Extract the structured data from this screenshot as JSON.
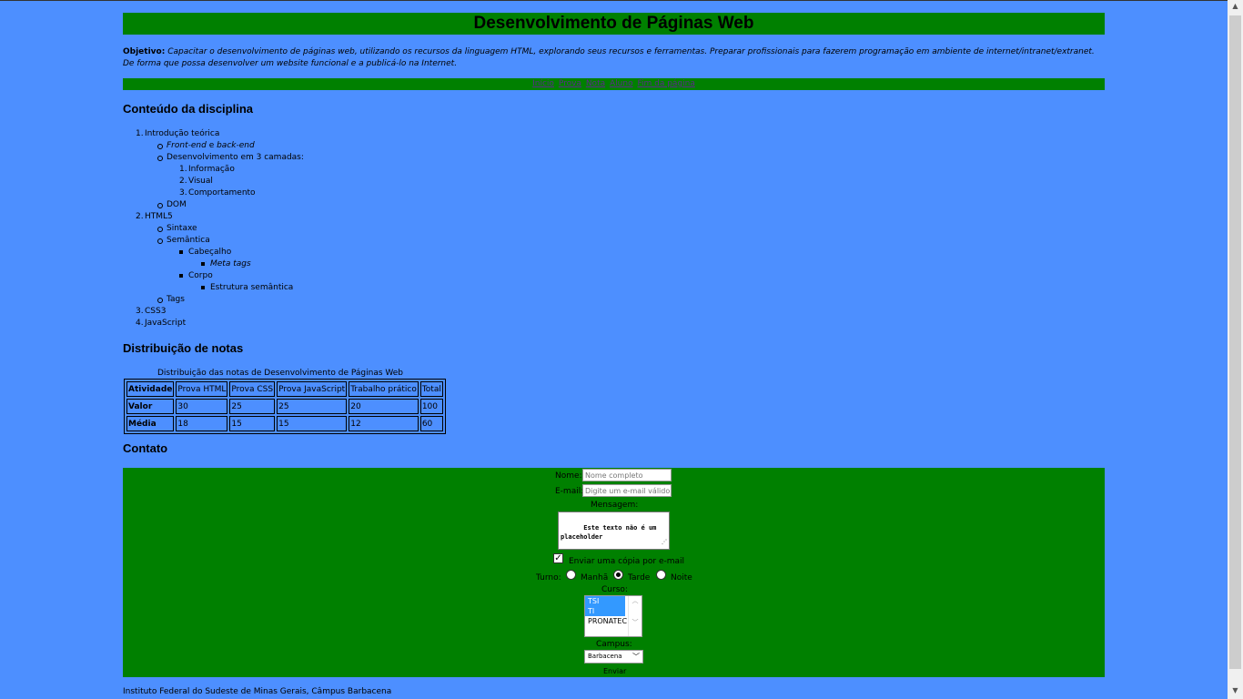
{
  "header": {
    "title": "Desenvolvimento de Páginas Web"
  },
  "objective": {
    "label": "Objetivo:",
    "text": "Capacitar o desenvolvimento de páginas web, utilizando os recursos da linguagem HTML, explorando seus recursos e ferramentas. Preparar profissionais para fazerem programação em ambiente de internet/intranet/extranet. De forma que possa desenvolver um website funcional e a publicá-lo na Internet."
  },
  "nav": [
    "Início",
    "Prova",
    "Nota",
    "Aluno",
    "Fim da página"
  ],
  "syllabus": {
    "heading": "Conteúdo da disciplina",
    "items": {
      "i1": "Introdução teórica",
      "i1a_em": "Front-end",
      "i1a_mid": " e ",
      "i1a_em2": "back-end",
      "i1b": "Desenvolvimento em 3 camadas:",
      "i1b1": "Informação",
      "i1b2": "Visual",
      "i1b3": "Comportamento",
      "i1c": "DOM",
      "i2": "HTML5",
      "i2a": "Sintaxe",
      "i2b": "Semântica",
      "i2b1": "Cabeçalho",
      "i2b1a": "Meta tags",
      "i2b2": "Corpo",
      "i2b2a": "Estrutura semântica",
      "i2c": "Tags",
      "i3": "CSS3",
      "i4": "JavaScript"
    }
  },
  "grades": {
    "heading": "Distribuição de notas",
    "caption": "Distribuição das notas de Desenvolvimento de Páginas Web",
    "columns": [
      "Atividade",
      "Prova HTML",
      "Prova CSS",
      "Prova JavaScript",
      "Trabalho prático",
      "Total"
    ],
    "rows": [
      [
        "Valor",
        "30",
        "25",
        "25",
        "20",
        "100"
      ],
      [
        "Média",
        "18",
        "15",
        "15",
        "12",
        "60"
      ]
    ]
  },
  "contact": {
    "heading": "Contato",
    "name_label": "Nome:",
    "name_placeholder": "Nome completo",
    "email_label": "E-mail:",
    "email_placeholder": "Digite um e-mail válido",
    "message_label": "Mensagem:",
    "message_value": "Este texto não é um placeholder",
    "copy_label": "Enviar uma cópia por e-mail",
    "copy_checked": true,
    "shift_label": "Turno:",
    "shifts": [
      "Manhã",
      "Tarde",
      "Noite"
    ],
    "shift_selected": "Tarde",
    "course_label": "Curso:",
    "courses": [
      "TSI",
      "TI",
      "PRONATEC"
    ],
    "courses_selected": [
      "TSI",
      "TI"
    ],
    "campus_label": "Campus:",
    "campus_value": "Barbacena",
    "submit_label": "Enviar"
  },
  "footer": {
    "text": "Instituto Federal do Sudeste de Minas Gerais, Câmpus Barbacena"
  },
  "colors": {
    "background": "#4d8fff",
    "green": "#008000",
    "selection": "#3399ff"
  }
}
